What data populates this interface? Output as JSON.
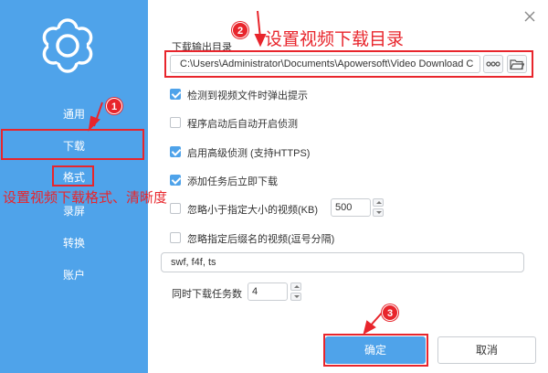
{
  "window": {
    "close_icon": "close-icon"
  },
  "sidebar": {
    "logo_icon": "gear-icon",
    "items": [
      {
        "label": "通用"
      },
      {
        "label": "下载"
      },
      {
        "label": "格式"
      },
      {
        "label": "录屏"
      },
      {
        "label": "转换"
      },
      {
        "label": "账户"
      }
    ]
  },
  "main": {
    "output_dir_label": "下载输出目录",
    "output_dir_value": "C:\\Users\\Administrator\\Documents\\Apowersoft\\Video Download C",
    "more_icon": "more-dots-icon",
    "folder_icon": "folder-icon",
    "options": [
      {
        "label": "检测到视频文件时弹出提示",
        "checked": true
      },
      {
        "label": "程序启动后自动开启侦测",
        "checked": false
      },
      {
        "label": "启用高级侦测 (支持HTTPS)",
        "checked": true
      },
      {
        "label": "添加任务后立即下载",
        "checked": true
      }
    ],
    "ignore_size": {
      "label": "忽略小于指定大小的视频(KB)",
      "checked": false,
      "value": "500"
    },
    "ignore_ext": {
      "label": "忽略指定后缀名的视频(逗号分隔)",
      "checked": false,
      "value": "swf, f4f, ts"
    },
    "concurrent": {
      "label": "同时下载任务数",
      "value": "4"
    },
    "ok_label": "确定",
    "cancel_label": "取消"
  },
  "annotations": {
    "step1": "1",
    "step2": "2",
    "step3": "3",
    "step2_text": "设置视频下载目录",
    "format_text": "设置视频下载格式、清晰度",
    "color": "#e8252c"
  }
}
